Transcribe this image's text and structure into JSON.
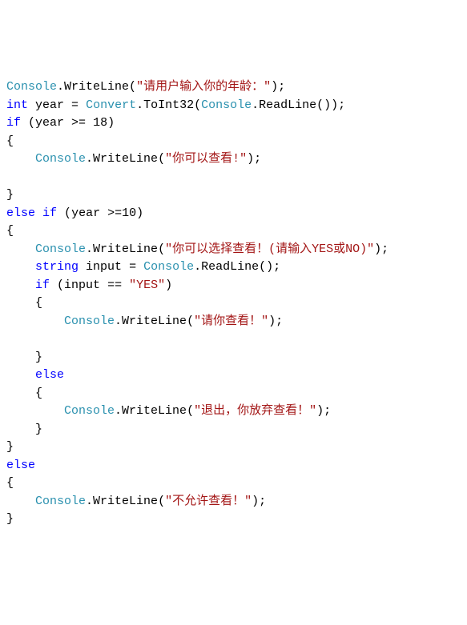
{
  "code": {
    "console": "Console",
    "writeline": "WriteLine",
    "convert": "Convert",
    "toint32": "ToInt32",
    "readline": "ReadLine",
    "int_kw": "int",
    "string_kw": "string",
    "if_kw": "if",
    "else_kw": "else",
    "year_var": "year",
    "input_var": "input",
    "str1": "\"请用户输入你的年龄：\"",
    "str2": "\"你可以查看!\"",
    "str3": "\"你可以选择查看！(请输入YES或NO)\"",
    "str4": "\"YES\"",
    "str5": "\"请你查看！\"",
    "str6": "\"退出，你放弃查看！\"",
    "str7": "\"不允许查看！\"",
    "num18": "18",
    "num10": "10"
  }
}
